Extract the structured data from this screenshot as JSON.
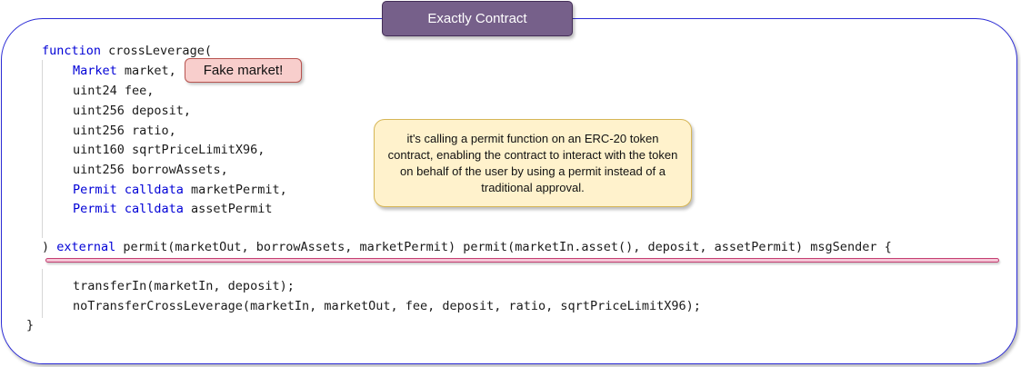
{
  "title": "Exactly Contract",
  "code": {
    "signature_open": {
      "keyword": "function",
      "text": " crossLeverage("
    },
    "params": [
      {
        "type": "Market",
        "type_keyword": true,
        "rest": " market,"
      },
      {
        "type": "uint24",
        "type_keyword": false,
        "rest": " fee,"
      },
      {
        "type": "uint256",
        "type_keyword": false,
        "rest": " deposit,"
      },
      {
        "type": "uint256",
        "type_keyword": false,
        "rest": " ratio,"
      },
      {
        "type": "uint160",
        "type_keyword": false,
        "rest": " sqrtPriceLimitX96,"
      },
      {
        "type": "uint256",
        "type_keyword": false,
        "rest": " borrowAssets,"
      },
      {
        "type": "Permit calldata",
        "type_keyword": true,
        "rest": " marketPermit,"
      },
      {
        "type": "Permit calldata",
        "type_keyword": true,
        "rest": " assetPermit"
      }
    ],
    "modifier_line": {
      "prefix": ") ",
      "keyword": "external",
      "rest": " permit(marketOut, borrowAssets, marketPermit) permit(marketIn.asset(), deposit, assetPermit) msgSender {"
    },
    "body": [
      "transferIn(marketIn, deposit);",
      "noTransferCrossLeverage(marketIn, marketOut, fee, deposit, ratio, sqrtPriceLimitX96);"
    ],
    "close": "}"
  },
  "annotations": {
    "fake_market": "Fake market!",
    "permit_note": "it's calling a permit function on an ERC-20 token contract, enabling the contract to interact with the token on behalf of the user by using a permit instead of a traditional approval."
  },
  "colors": {
    "keyword": "#0000d6",
    "frame_border": "#2b2bd6",
    "title_fill": "#76608a",
    "fake_fill": "#f8cecc",
    "note_fill": "#fff2cc",
    "highlight_line": "#c43e72"
  }
}
